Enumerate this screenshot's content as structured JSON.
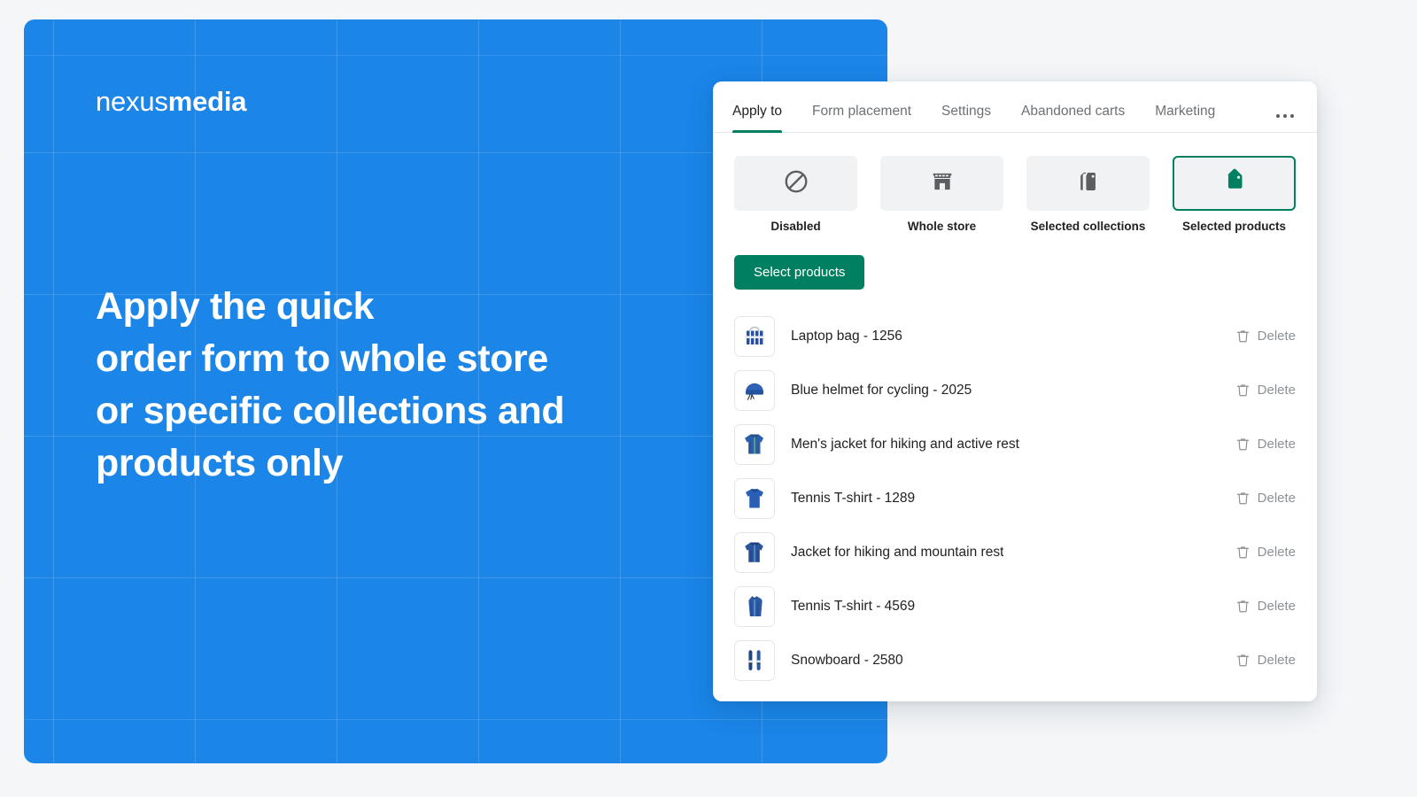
{
  "promo": {
    "logo": {
      "thin": "nexus",
      "bold": "media"
    },
    "headline_lines": [
      "Apply the quick",
      "order form to whole store",
      "or specific collections and",
      "products only"
    ],
    "background_color": "#1b85e8"
  },
  "card": {
    "tabs": [
      {
        "label": "Apply to",
        "active": true
      },
      {
        "label": "Form placement",
        "active": false
      },
      {
        "label": "Settings",
        "active": false
      },
      {
        "label": "Abandoned carts",
        "active": false
      },
      {
        "label": "Marketing",
        "active": false
      }
    ],
    "more_menu": "more-options",
    "accent_color": "#008060",
    "options": [
      {
        "label": "Disabled",
        "icon": "no-entry-icon",
        "selected": false
      },
      {
        "label": "Whole store",
        "icon": "storefront-icon",
        "selected": false
      },
      {
        "label": "Selected collections",
        "icon": "collections-tags-icon",
        "selected": false
      },
      {
        "label": "Selected products",
        "icon": "price-tag-icon",
        "selected": true
      }
    ],
    "select_products_label": "Select products",
    "delete_label": "Delete",
    "products": [
      {
        "name": "Laptop bag - 1256",
        "thumb": "laptop-bag"
      },
      {
        "name": "Blue helmet for cycling - 2025",
        "thumb": "helmet"
      },
      {
        "name": "Men's jacket for hiking and active rest",
        "thumb": "hoodie"
      },
      {
        "name": "Tennis T-shirt - 1289",
        "thumb": "polo"
      },
      {
        "name": "Jacket for hiking and mountain rest",
        "thumb": "jacket"
      },
      {
        "name": "Tennis T-shirt - 4569",
        "thumb": "tank"
      },
      {
        "name": "Snowboard - 2580",
        "thumb": "skis"
      }
    ]
  }
}
